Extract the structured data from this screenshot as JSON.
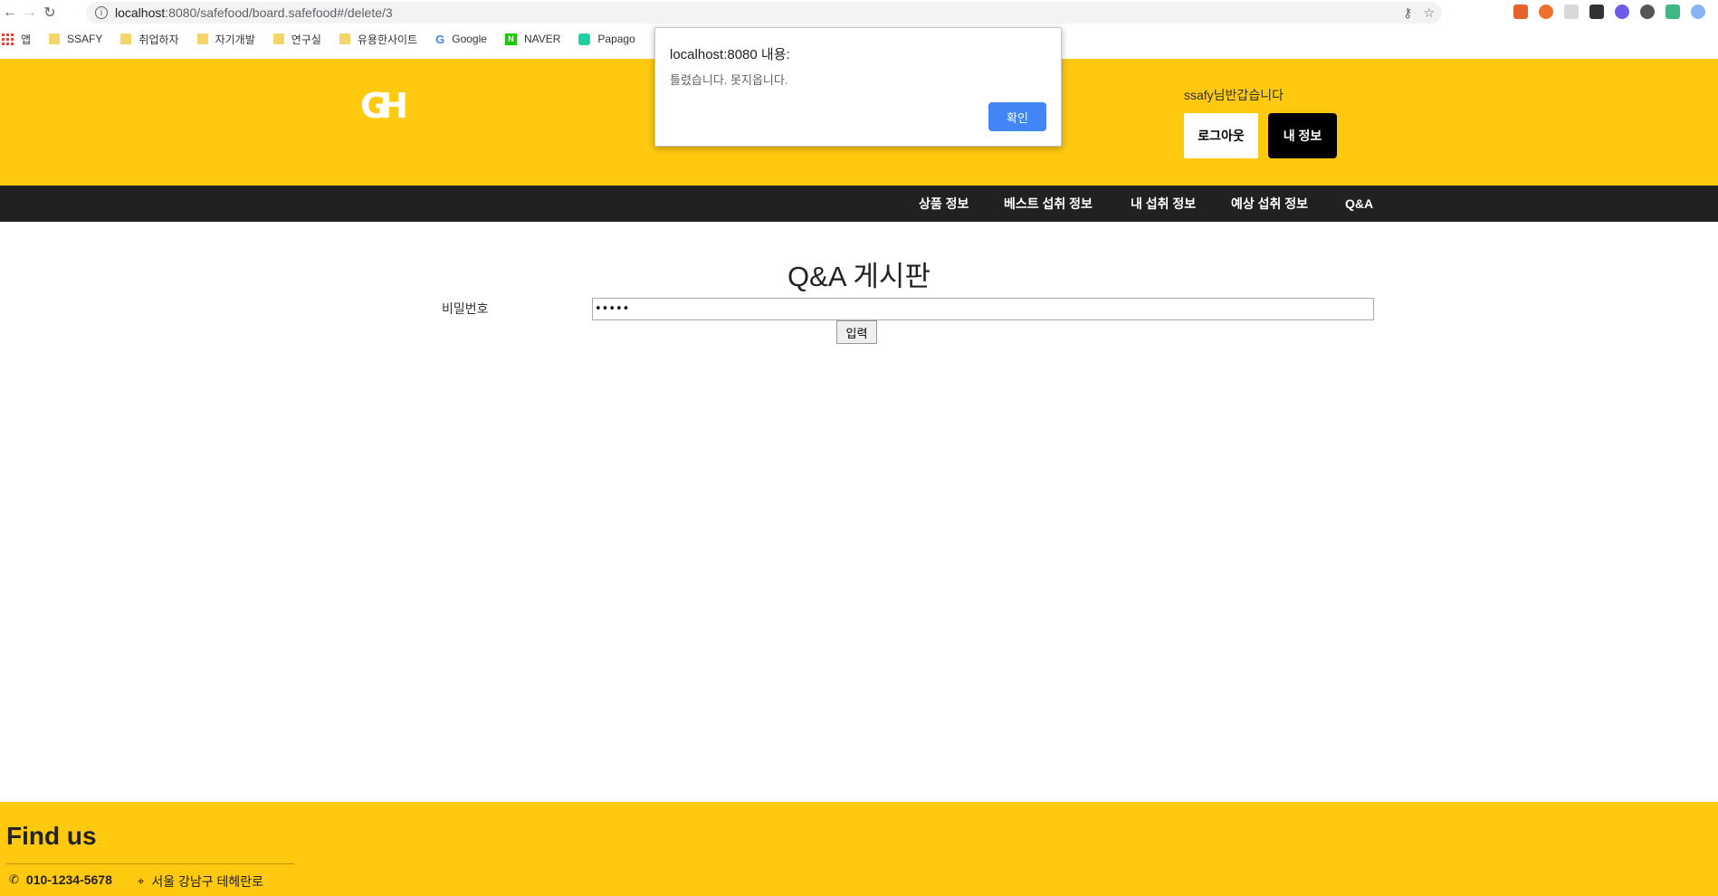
{
  "browser": {
    "url_host": "localhost",
    "url_path": ":8080/safefood/board.safefood#/delete/3"
  },
  "bookmarks": [
    {
      "label": "앱",
      "icon": "apps-icon"
    },
    {
      "label": "SSAFY",
      "icon": "folder-icon"
    },
    {
      "label": "취업하자",
      "icon": "folder-icon"
    },
    {
      "label": "자기개발",
      "icon": "folder-icon"
    },
    {
      "label": "연구실",
      "icon": "folder-icon"
    },
    {
      "label": "유용한사이트",
      "icon": "folder-icon"
    },
    {
      "label": "Google",
      "icon": "google-icon"
    },
    {
      "label": "NAVER",
      "icon": "naver-icon"
    },
    {
      "label": "Papago",
      "icon": "papago-icon"
    }
  ],
  "header": {
    "logo": "GH",
    "greeting": "ssafy님반갑습니다",
    "logout_label": "로그아웃",
    "myinfo_label": "내 정보"
  },
  "nav": {
    "items": [
      "상품 정보",
      "베스트 섭취 정보",
      "내 섭취 정보",
      "예상 섭취 정보",
      "Q&A"
    ]
  },
  "main": {
    "title": "Q&A 게시판",
    "password_label": "비밀번호",
    "password_value": "•••••",
    "submit_label": "입력"
  },
  "dialog": {
    "title": "localhost:8080 내용:",
    "message": "틀렸습니다. 못지옵니다.",
    "ok_label": "확인"
  },
  "footer": {
    "title": "Find us",
    "phone": "010-1234-5678",
    "address": "서울 강남구 테헤란로"
  },
  "colors": {
    "brand": "#ffc90f",
    "nav_bg": "#212121",
    "dialog_button": "#4285f4"
  }
}
